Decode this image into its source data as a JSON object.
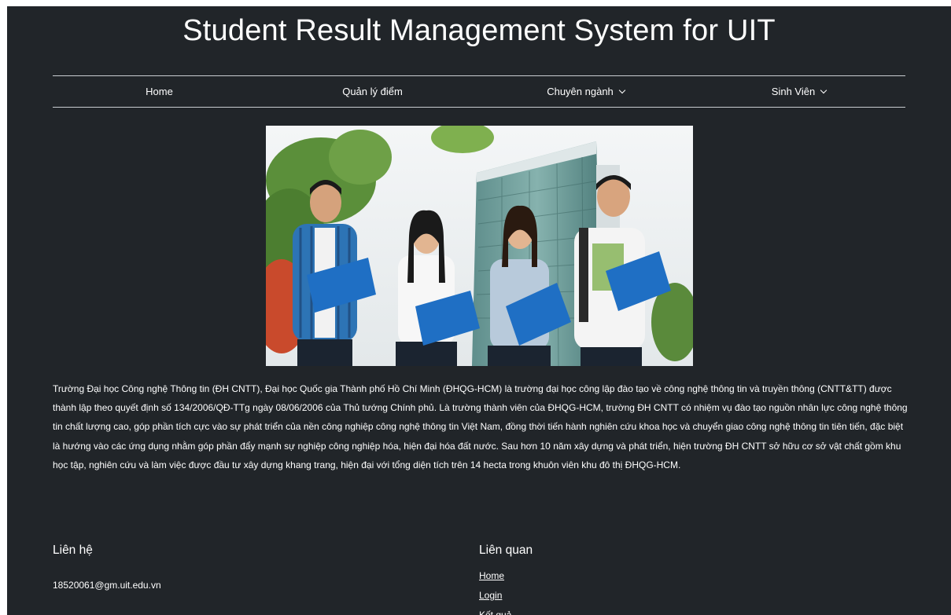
{
  "header": {
    "title": "Student Result Management System for UIT"
  },
  "nav": {
    "items": [
      {
        "label": "Home"
      },
      {
        "label": "Quản lý điểm"
      },
      {
        "label": "Chuyên ngành"
      },
      {
        "label": "Sinh Viên"
      }
    ]
  },
  "intro": {
    "text": "Trường Đại học Công nghệ Thông tin (ĐH CNTT), Đại học Quốc gia Thành phố Hồ Chí Minh (ĐHQG-HCM) là trường đại học công lập đào tạo về công nghệ thông tin và truyền thông (CNTT&TT) được thành lập theo quyết định số 134/2006/QĐ-TTg ngày 08/06/2006 của Thủ tướng Chính phủ. Là trường thành viên của ĐHQG-HCM, trường ĐH CNTT có nhiệm vụ đào tạo nguồn nhân lực công nghệ thông tin chất lượng cao, góp phần tích cực vào sự phát triển của nền công nghiệp công nghệ thông tin Việt Nam, đồng thời tiến hành nghiên cứu khoa học và chuyển giao công nghệ thông tin tiên tiến, đặc biệt là hướng vào các ứng dụng nhằm góp phần đẩy mạnh sự nghiệp công nghiệp hóa, hiện đại hóa đất nước. Sau hơn 10 năm xây dựng và phát triển, hiện trường ĐH CNTT sở hữu cơ sở vật chất gồm khu học tập, nghiên cứu và làm việc được đầu tư xây dựng khang trang, hiện đại với tổng diện tích trên 14 hecta trong khuôn viên khu đô thị ĐHQG-HCM."
  },
  "footer": {
    "contact_heading": "Liên hệ",
    "email": "18520061@gm.uit.edu.vn",
    "links_heading": "Liên quan",
    "links": [
      {
        "label": "Home"
      },
      {
        "label": "Login"
      },
      {
        "label": "Kết quả"
      }
    ]
  },
  "colors": {
    "background": "#212529",
    "text": "#ffffff",
    "divider": "#c9cdd1"
  }
}
